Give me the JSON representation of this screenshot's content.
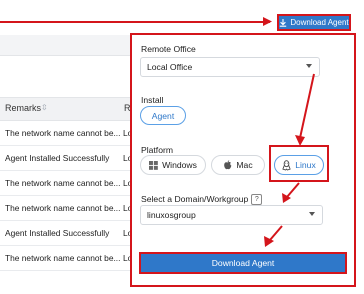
{
  "top_button": {
    "label": "Download Agent",
    "icon": "download-icon"
  },
  "table": {
    "headers": {
      "remarks": "Remarks",
      "next": "Re"
    },
    "rows": [
      {
        "remarks": "The network name cannot be...",
        "next": "Lo"
      },
      {
        "remarks": "Agent Installed Successfully",
        "next": "Lo"
      },
      {
        "remarks": "The network name cannot be...",
        "next": "Lo"
      },
      {
        "remarks": "The network name cannot be...",
        "next": "Lo"
      },
      {
        "remarks": "Agent Installed Successfully",
        "next": "Lo"
      },
      {
        "remarks": "The network name cannot be...",
        "next": "Lo"
      }
    ]
  },
  "panel": {
    "remote_office": {
      "label": "Remote Office",
      "value": "Local Office"
    },
    "install": {
      "label": "Install",
      "option": "Agent"
    },
    "platform": {
      "label": "Platform",
      "options": [
        {
          "label": "Windows",
          "icon": "windows-icon"
        },
        {
          "label": "Mac",
          "icon": "apple-icon"
        },
        {
          "label": "Linux",
          "icon": "linux-icon",
          "selected": true
        }
      ]
    },
    "domain": {
      "label": "Select a Domain/Workgroup",
      "help": "?",
      "value": "linuxosgroup"
    },
    "download_label": "Download Agent"
  },
  "colors": {
    "accent": "#2f78c9",
    "annotation": "#d4151b",
    "selected_border": "#5ba0e6"
  }
}
